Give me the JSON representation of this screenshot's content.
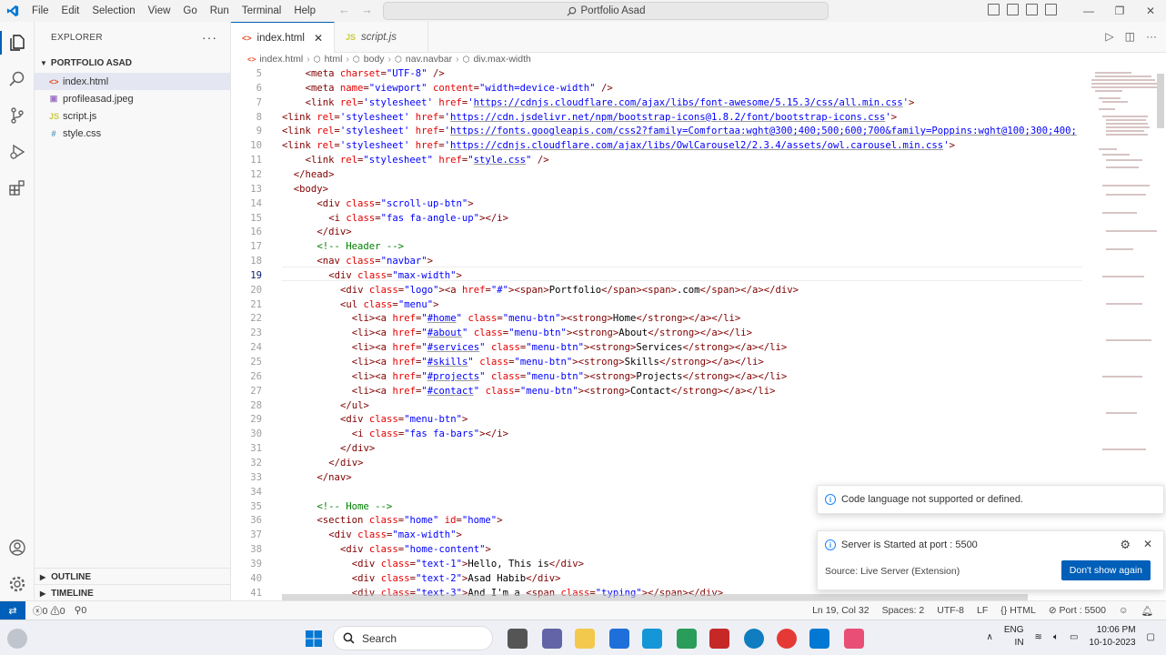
{
  "titlebar": {
    "menu": [
      "File",
      "Edit",
      "Selection",
      "View",
      "Go",
      "Run",
      "Terminal",
      "Help"
    ],
    "search_text": "Portfolio Asad"
  },
  "explorer": {
    "title": "EXPLORER",
    "folder": "PORTFOLIO ASAD",
    "files": [
      {
        "name": "index.html",
        "icon": "html-icon"
      },
      {
        "name": "profileasad.jpeg",
        "icon": "image-icon"
      },
      {
        "name": "script.js",
        "icon": "js-icon"
      },
      {
        "name": "style.css",
        "icon": "css-icon"
      }
    ],
    "outline": "OUTLINE",
    "timeline": "TIMELINE"
  },
  "tabs": [
    {
      "label": "index.html",
      "active": true
    },
    {
      "label": "script.js",
      "active": false
    }
  ],
  "breadcrumb": [
    "index.html",
    "html",
    "body",
    "nav.navbar",
    "div.max-width"
  ],
  "code_lines": [
    {
      "n": "5",
      "indent": 2,
      "html": "<span class='t-tag'>&lt;meta</span> <span class='t-attr'>charset</span>=<span class='t-str'>\"UTF-8\"</span> <span class='t-tag'>/&gt;</span>"
    },
    {
      "n": "6",
      "indent": 2,
      "html": "<span class='t-tag'>&lt;meta</span> <span class='t-attr'>name</span>=<span class='t-str'>\"viewport\"</span> <span class='t-attr'>content</span>=<span class='t-str'>\"width=device-width\"</span> <span class='t-tag'>/&gt;</span>"
    },
    {
      "n": "7",
      "indent": 2,
      "html": "<span class='t-tag'>&lt;link</span> <span class='t-attr'>rel</span>=<span class='t-str'>'stylesheet'</span> <span class='t-attr'>href</span>=<span class='t-str'>'<span class=\"t-link\">https://cdnjs.cloudflare.com/ajax/libs/font-awesome/5.15.3/css/all.min.css</span>'</span><span class='t-tag'>&gt;</span>"
    },
    {
      "n": "8",
      "indent": 0,
      "html": "<span class='t-tag'>&lt;link</span> <span class='t-attr'>rel</span>=<span class='t-str'>'stylesheet'</span> <span class='t-attr'>href</span>=<span class='t-str'>'<span class=\"t-link\">https://cdn.jsdelivr.net/npm/bootstrap-icons@1.8.2/font/bootstrap-icons.css</span>'</span><span class='t-tag'>&gt;</span>"
    },
    {
      "n": "9",
      "indent": 0,
      "html": "<span class='t-tag'>&lt;link</span> <span class='t-attr'>rel</span>=<span class='t-str'>'stylesheet'</span> <span class='t-attr'>href</span>=<span class='t-str'>'<span class=\"t-link\">https://fonts.googleapis.com/css2?family=Comfortaa:wght@300;400;500;600;700&amp;family=Poppins:wght@100;300;400;</span></span>"
    },
    {
      "n": "10",
      "indent": 0,
      "html": "<span class='t-tag'>&lt;link</span> <span class='t-attr'>rel</span>=<span class='t-str'>'stylesheet'</span> <span class='t-attr'>href</span>=<span class='t-str'>'<span class=\"t-link\">https://cdnjs.cloudflare.com/ajax/libs/OwlCarousel2/2.3.4/assets/owl.carousel.min.css</span>'</span><span class='t-tag'>&gt;</span>"
    },
    {
      "n": "11",
      "indent": 2,
      "html": "<span class='t-tag'>&lt;link</span> <span class='t-attr'>rel</span>=<span class='t-str'>\"stylesheet\"</span> <span class='t-attr'>href</span>=<span class='t-str'>\"<span class=\"t-link\">style.css</span>\"</span> <span class='t-tag'>/&gt;</span>"
    },
    {
      "n": "12",
      "indent": 1,
      "html": "<span class='t-tag'>&lt;/head&gt;</span>"
    },
    {
      "n": "13",
      "indent": 1,
      "html": "<span class='t-tag'>&lt;body&gt;</span>"
    },
    {
      "n": "14",
      "indent": 3,
      "html": "<span class='t-tag'>&lt;div</span> <span class='t-attr'>class</span>=<span class='t-str'>\"scroll-up-btn\"</span><span class='t-tag'>&gt;</span>"
    },
    {
      "n": "15",
      "indent": 4,
      "html": "<span class='t-tag'>&lt;i</span> <span class='t-attr'>class</span>=<span class='t-str'>\"fas fa-angle-up\"</span><span class='t-tag'>&gt;&lt;/i&gt;</span>"
    },
    {
      "n": "16",
      "indent": 3,
      "html": "<span class='t-tag'>&lt;/div&gt;</span>"
    },
    {
      "n": "17",
      "indent": 3,
      "html": "<span class='t-com'>&lt;!-- Header --&gt;</span>"
    },
    {
      "n": "18",
      "indent": 3,
      "html": "<span class='t-tag'>&lt;nav</span> <span class='t-attr'>class</span>=<span class='t-str'>\"navbar\"</span><span class='t-tag'>&gt;</span>"
    },
    {
      "n": "19",
      "indent": 4,
      "html": "<span class='t-tag'>&lt;div</span> <span class='t-attr'>class</span>=<span class='t-str'>\"max-width\"</span><span class='t-tag'>&gt;</span>"
    },
    {
      "n": "20",
      "indent": 5,
      "html": "<span class='t-tag'>&lt;div</span> <span class='t-attr'>class</span>=<span class='t-str'>\"logo\"</span><span class='t-tag'>&gt;&lt;a</span> <span class='t-attr'>href</span>=<span class='t-str'>\"#\"</span><span class='t-tag'>&gt;&lt;span&gt;</span><span class='t-txt'>Portfolio</span><span class='t-tag'>&lt;/span&gt;&lt;span&gt;</span><span class='t-txt'>.com</span><span class='t-tag'>&lt;/span&gt;&lt;/a&gt;&lt;/div&gt;</span>"
    },
    {
      "n": "21",
      "indent": 5,
      "html": "<span class='t-tag'>&lt;ul</span> <span class='t-attr'>class</span>=<span class='t-str'>\"menu\"</span><span class='t-tag'>&gt;</span>"
    },
    {
      "n": "22",
      "indent": 6,
      "html": "<span class='t-tag'>&lt;li&gt;&lt;a</span> <span class='t-attr'>href</span>=<span class='t-str'>\"<span class=\"t-link\">#home</span>\"</span> <span class='t-attr'>class</span>=<span class='t-str'>\"menu-btn\"</span><span class='t-tag'>&gt;&lt;strong&gt;</span><span class='t-txt'>Home</span><span class='t-tag'>&lt;/strong&gt;&lt;/a&gt;&lt;/li&gt;</span>"
    },
    {
      "n": "23",
      "indent": 6,
      "html": "<span class='t-tag'>&lt;li&gt;&lt;a</span> <span class='t-attr'>href</span>=<span class='t-str'>\"<span class=\"t-link\">#about</span>\"</span> <span class='t-attr'>class</span>=<span class='t-str'>\"menu-btn\"</span><span class='t-tag'>&gt;&lt;strong&gt;</span><span class='t-txt'>About</span><span class='t-tag'>&lt;/strong&gt;&lt;/a&gt;&lt;/li&gt;</span>"
    },
    {
      "n": "24",
      "indent": 6,
      "html": "<span class='t-tag'>&lt;li&gt;&lt;a</span> <span class='t-attr'>href</span>=<span class='t-str'>\"<span class=\"t-link\">#services</span>\"</span> <span class='t-attr'>class</span>=<span class='t-str'>\"menu-btn\"</span><span class='t-tag'>&gt;&lt;strong&gt;</span><span class='t-txt'>Services</span><span class='t-tag'>&lt;/strong&gt;&lt;/a&gt;&lt;/li&gt;</span>"
    },
    {
      "n": "25",
      "indent": 6,
      "html": "<span class='t-tag'>&lt;li&gt;&lt;a</span> <span class='t-attr'>href</span>=<span class='t-str'>\"<span class=\"t-link\">#skills</span>\"</span> <span class='t-attr'>class</span>=<span class='t-str'>\"menu-btn\"</span><span class='t-tag'>&gt;&lt;strong&gt;</span><span class='t-txt'>Skills</span><span class='t-tag'>&lt;/strong&gt;&lt;/a&gt;&lt;/li&gt;</span>"
    },
    {
      "n": "26",
      "indent": 6,
      "html": "<span class='t-tag'>&lt;li&gt;&lt;a</span> <span class='t-attr'>href</span>=<span class='t-str'>\"<span class=\"t-link\">#projects</span>\"</span> <span class='t-attr'>class</span>=<span class='t-str'>\"menu-btn\"</span><span class='t-tag'>&gt;&lt;strong&gt;</span><span class='t-txt'>Projects</span><span class='t-tag'>&lt;/strong&gt;&lt;/a&gt;&lt;/li&gt;</span>"
    },
    {
      "n": "27",
      "indent": 6,
      "html": "<span class='t-tag'>&lt;li&gt;&lt;a</span> <span class='t-attr'>href</span>=<span class='t-str'>\"<span class=\"t-link\">#contact</span>\"</span> <span class='t-attr'>class</span>=<span class='t-str'>\"menu-btn\"</span><span class='t-tag'>&gt;&lt;strong&gt;</span><span class='t-txt'>Contact</span><span class='t-tag'>&lt;/strong&gt;&lt;/a&gt;&lt;/li&gt;</span>"
    },
    {
      "n": "28",
      "indent": 5,
      "html": "<span class='t-tag'>&lt;/ul&gt;</span>"
    },
    {
      "n": "29",
      "indent": 5,
      "html": "<span class='t-tag'>&lt;div</span> <span class='t-attr'>class</span>=<span class='t-str'>\"menu-btn\"</span><span class='t-tag'>&gt;</span>"
    },
    {
      "n": "30",
      "indent": 6,
      "html": "<span class='t-tag'>&lt;i</span> <span class='t-attr'>class</span>=<span class='t-str'>\"fas fa-bars\"</span><span class='t-tag'>&gt;&lt;/i&gt;</span>"
    },
    {
      "n": "31",
      "indent": 5,
      "html": "<span class='t-tag'>&lt;/div&gt;</span>"
    },
    {
      "n": "32",
      "indent": 4,
      "html": "<span class='t-tag'>&lt;/div&gt;</span>"
    },
    {
      "n": "33",
      "indent": 3,
      "html": "<span class='t-tag'>&lt;/nav&gt;</span>"
    },
    {
      "n": "34",
      "indent": 0,
      "html": ""
    },
    {
      "n": "35",
      "indent": 3,
      "html": "<span class='t-com'>&lt;!-- Home --&gt;</span>"
    },
    {
      "n": "36",
      "indent": 3,
      "html": "<span class='t-tag'>&lt;section</span> <span class='t-attr'>class</span>=<span class='t-str'>\"home\"</span> <span class='t-attr'>id</span>=<span class='t-str'>\"home\"</span><span class='t-tag'>&gt;</span>"
    },
    {
      "n": "37",
      "indent": 4,
      "html": "<span class='t-tag'>&lt;div</span> <span class='t-attr'>class</span>=<span class='t-str'>\"max-width\"</span><span class='t-tag'>&gt;</span>"
    },
    {
      "n": "38",
      "indent": 5,
      "html": "<span class='t-tag'>&lt;div</span> <span class='t-attr'>class</span>=<span class='t-str'>\"home-content\"</span><span class='t-tag'>&gt;</span>"
    },
    {
      "n": "39",
      "indent": 6,
      "html": "<span class='t-tag'>&lt;div</span> <span class='t-attr'>class</span>=<span class='t-str'>\"text-1\"</span><span class='t-tag'>&gt;</span><span class='t-txt'>Hello, This is</span><span class='t-tag'>&lt;/div&gt;</span>"
    },
    {
      "n": "40",
      "indent": 6,
      "html": "<span class='t-tag'>&lt;div</span> <span class='t-attr'>class</span>=<span class='t-str'>\"text-2\"</span><span class='t-tag'>&gt;</span><span class='t-txt'>Asad Habib</span><span class='t-tag'>&lt;/div&gt;</span>"
    },
    {
      "n": "41",
      "indent": 6,
      "html": "<span class='t-tag'>&lt;div</span> <span class='t-attr'>class</span>=<span class='t-str'>\"text-3\"</span><span class='t-tag'>&gt;</span><span class='t-txt'>And I'm a </span><span class='t-tag'>&lt;span</span> <span class='t-attr'>class</span>=<span class='t-str'>\"typing\"</span><span class='t-tag'>&gt;&lt;/span&gt;&lt;/div&gt;</span>"
    }
  ],
  "current_line": "19",
  "notifications": {
    "lang": "Code language not supported or defined.",
    "server": "Server is Started at port : 5500",
    "source": "Source: Live Server (Extension)",
    "dont_show": "Don't show again"
  },
  "status": {
    "errors": "0",
    "warnings": "0",
    "ports": "0",
    "position": "Ln 19, Col 32",
    "spaces": "Spaces: 2",
    "encoding": "UTF-8",
    "eol": "LF",
    "language": "HTML",
    "port": "Port : 5500"
  },
  "taskbar": {
    "search": "Search",
    "lang1": "ENG",
    "lang2": "IN",
    "time": "10:06 PM",
    "date": "10-10-2023"
  },
  "colors": {
    "accent": "#005fb8",
    "tag": "#800000",
    "attr": "#e50000",
    "string": "#0000ff",
    "comment": "#008000"
  }
}
